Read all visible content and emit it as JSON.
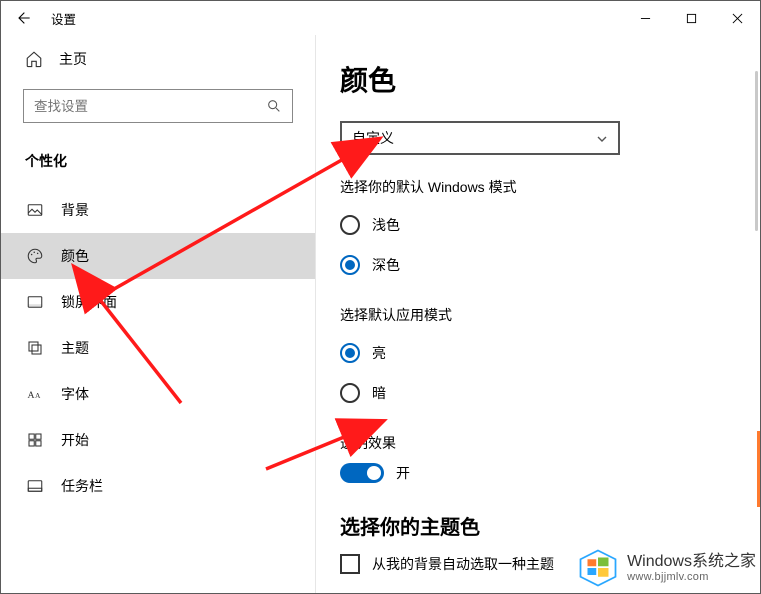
{
  "window": {
    "title": "设置"
  },
  "sidebar": {
    "home": "主页",
    "search_placeholder": "查找设置",
    "section": "个性化",
    "items": [
      {
        "key": "background",
        "label": "背景"
      },
      {
        "key": "colors",
        "label": "颜色",
        "selected": true
      },
      {
        "key": "lockscreen",
        "label": "锁屏界面"
      },
      {
        "key": "themes",
        "label": "主题"
      },
      {
        "key": "fonts",
        "label": "字体"
      },
      {
        "key": "start",
        "label": "开始"
      },
      {
        "key": "taskbar",
        "label": "任务栏"
      }
    ]
  },
  "content": {
    "page_title": "颜色",
    "color_mode_select": {
      "value": "自定义"
    },
    "windows_mode": {
      "heading": "选择你的默认 Windows 模式",
      "options": [
        {
          "key": "light",
          "label": "浅色",
          "checked": false
        },
        {
          "key": "dark",
          "label": "深色",
          "checked": true
        }
      ]
    },
    "app_mode": {
      "heading": "选择默认应用模式",
      "options": [
        {
          "key": "light",
          "label": "亮",
          "checked": true
        },
        {
          "key": "dark",
          "label": "暗",
          "checked": false
        }
      ]
    },
    "transparency": {
      "heading": "透明效果",
      "state_label": "开",
      "on": true
    },
    "accent": {
      "heading": "选择你的主题色",
      "auto_checkbox_label": "从我的背景自动选取一种主题"
    }
  },
  "watermark": {
    "brand": "Windows",
    "brand_suffix": "系统之家",
    "url": "www.bjjmlv.com"
  }
}
